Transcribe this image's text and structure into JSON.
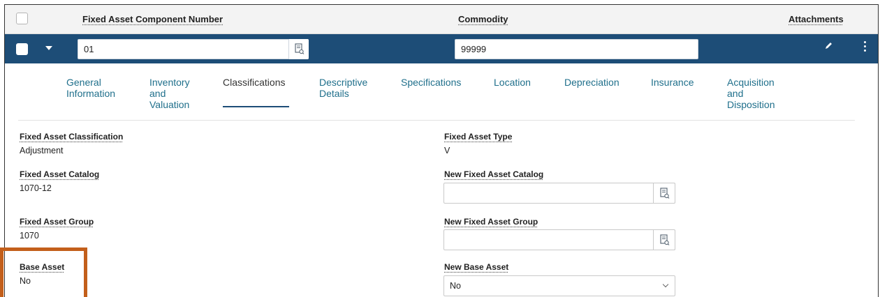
{
  "header": {
    "col_component_number": "Fixed Asset Component Number",
    "col_commodity": "Commodity",
    "col_attachments": "Attachments"
  },
  "row": {
    "component_number_value": "01",
    "commodity_value": "99999"
  },
  "tabs": [
    {
      "label_lines": [
        "General",
        "Information"
      ]
    },
    {
      "label_lines": [
        "Inventory",
        "and",
        "Valuation"
      ]
    },
    {
      "label_lines": [
        "Classifications"
      ]
    },
    {
      "label_lines": [
        "Descriptive",
        "Details"
      ]
    },
    {
      "label_lines": [
        "Specifications"
      ]
    },
    {
      "label_lines": [
        "Location"
      ]
    },
    {
      "label_lines": [
        "Depreciation"
      ]
    },
    {
      "label_lines": [
        "Insurance"
      ]
    },
    {
      "label_lines": [
        "Acquisition",
        "and",
        "Disposition"
      ]
    }
  ],
  "active_tab": "Classifications",
  "form": {
    "classification_label": "Fixed Asset Classification",
    "classification_value": "Adjustment",
    "type_label": "Fixed Asset Type",
    "type_value": "V",
    "catalog_label": "Fixed Asset Catalog",
    "catalog_value": "1070-12",
    "new_catalog_label": "New Fixed Asset Catalog",
    "new_catalog_value": "",
    "group_label": "Fixed Asset Group",
    "group_value": "1070",
    "new_group_label": "New Fixed Asset Group",
    "new_group_value": "",
    "base_asset_label": "Base Asset",
    "base_asset_value": "No",
    "new_base_asset_label": "New Base Asset",
    "new_base_asset_value": "No"
  },
  "colors": {
    "row_bg": "#1d4d77",
    "tab_link": "#1f6f8b",
    "highlight": "#c35f1b"
  },
  "icons": {
    "lookup": "lookup-icon",
    "pencil": "pencil-icon",
    "kebab": "kebab-menu-icon",
    "caret": "caret-down-icon",
    "chevron": "chevron-down-icon"
  }
}
